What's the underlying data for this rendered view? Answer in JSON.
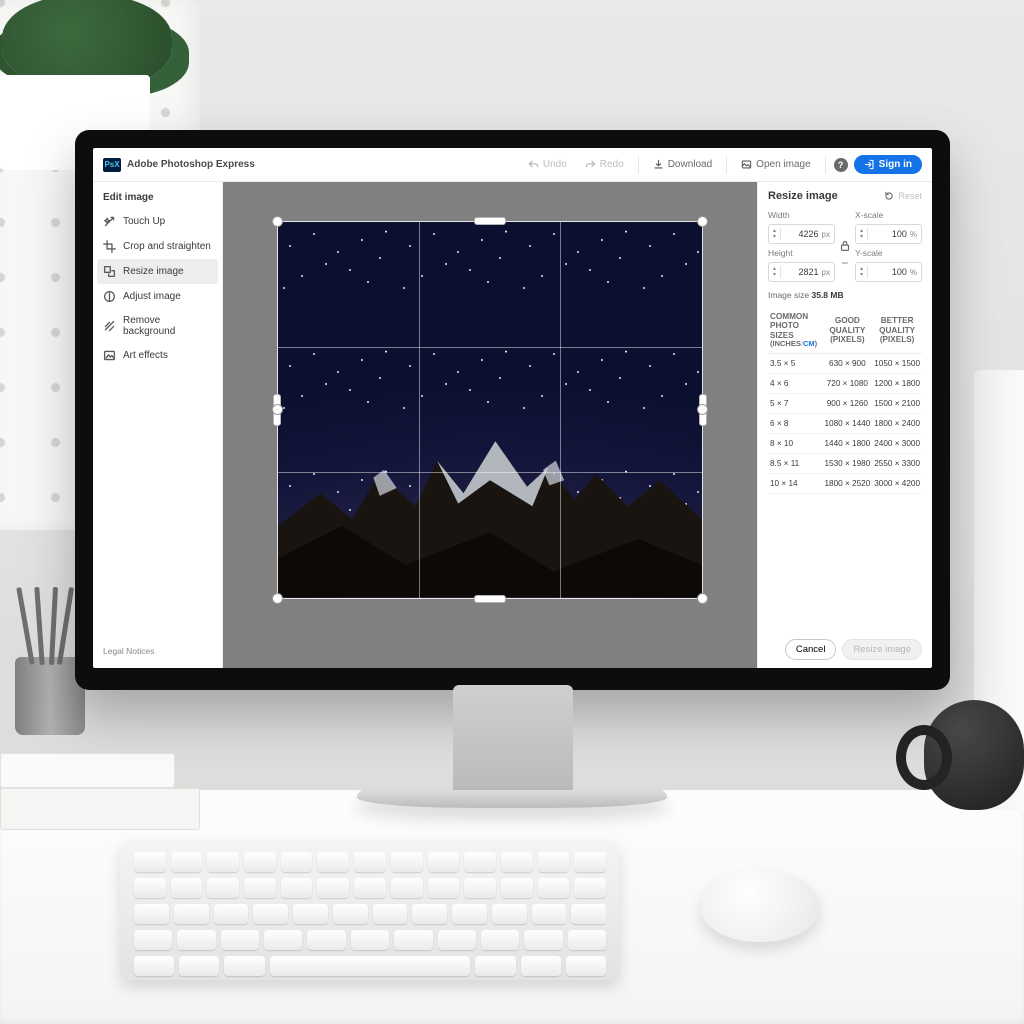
{
  "app": {
    "title": "Adobe Photoshop Express",
    "brand_abbr": "PsX"
  },
  "topbar": {
    "undo": "Undo",
    "redo": "Redo",
    "download": "Download",
    "open_image": "Open image",
    "sign_in": "Sign in"
  },
  "sidebar": {
    "heading": "Edit image",
    "items": [
      {
        "label": "Touch Up"
      },
      {
        "label": "Crop and straighten"
      },
      {
        "label": "Resize image"
      },
      {
        "label": "Adjust image"
      },
      {
        "label": "Remove background"
      },
      {
        "label": "Art effects"
      }
    ],
    "legal": "Legal Notices"
  },
  "panel": {
    "title": "Resize image",
    "reset": "Reset",
    "width_label": "Width",
    "height_label": "Height",
    "xscale_label": "X-scale",
    "yscale_label": "Y-scale",
    "width_value": "4226",
    "height_value": "2821",
    "px_unit": "px",
    "xscale_value": "100",
    "yscale_value": "100",
    "pct_unit": "%",
    "image_size_label": "Image size",
    "image_size_value": "35.8 MB",
    "table": {
      "col1_l1": "COMMON",
      "col1_l2": "PHOTO SIZES",
      "col1_unit_inches": "INCHES",
      "col1_unit_cm": "CM",
      "col2_l1": "GOOD",
      "col2_l2": "QUALITY",
      "col2_l3": "(PIXELS)",
      "col3_l1": "BETTER",
      "col3_l2": "QUALITY",
      "col3_l3": "(PIXELS)",
      "rows": [
        {
          "size": "3.5 × 5",
          "good": "630 × 900",
          "better": "1050 × 1500"
        },
        {
          "size": "4 × 6",
          "good": "720 × 1080",
          "better": "1200 × 1800"
        },
        {
          "size": "5 × 7",
          "good": "900 × 1260",
          "better": "1500 × 2100"
        },
        {
          "size": "6 × 8",
          "good": "1080 × 1440",
          "better": "1800 × 2400"
        },
        {
          "size": "8 × 10",
          "good": "1440 × 1800",
          "better": "2400 × 3000"
        },
        {
          "size": "8.5 × 11",
          "good": "1530 × 1980",
          "better": "2550 × 3300"
        },
        {
          "size": "10 × 14",
          "good": "1800 × 2520",
          "better": "3000 × 4200"
        }
      ]
    },
    "cancel": "Cancel",
    "apply": "Resize image"
  }
}
